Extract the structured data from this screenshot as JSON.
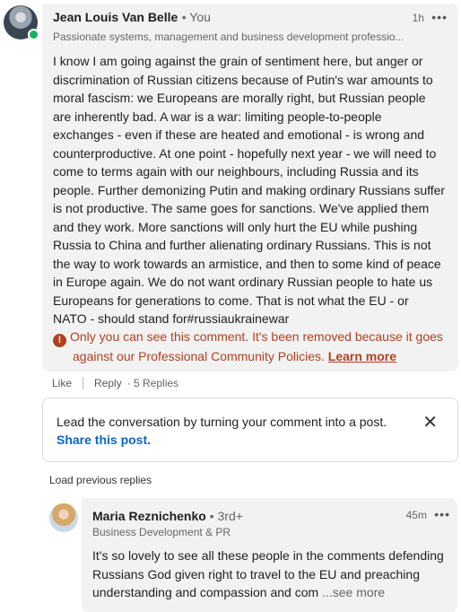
{
  "comment": {
    "author": "Jean Louis Van Belle",
    "author_suffix": "• You",
    "time": "1h",
    "menu_icon": "ellipsis-icon",
    "headline": "Passionate systems, management and business development professio...",
    "body": "I know I am going against the grain of sentiment here, but anger or discrimination of Russian citizens because of Putin's war amounts to moral fascism: we Europeans are morally right, but Russian people are inherently bad. A war is a war: limiting people-to-people exchanges - even if these are heated and emotional - is wrong and counterproductive. At one point - hopefully next year - we will need to come to terms again with our neighbours, including Russia and its people. Further demonizing Putin and making ordinary Russians suffer is not productive. The same goes for sanctions. We've applied them and they work. More sanctions will only hurt the EU while pushing Russia to China and further alienating ordinary Russians. This is not the way to work towards an armistice, and then to some kind of peace in Europe again. We do not want ordinary Russian people to hate us Europeans for generations to come. That is not what the EU - or NATO - should stand for#russiaukrainewar",
    "warning_icon": "warning-icon",
    "warning_line1": "Only you can see this comment. It's been removed because it goes",
    "warning_line2": "against our Professional Community Policies.",
    "learn_more": "Learn more",
    "online_color": "#19b05f",
    "warning_color": "#b24020"
  },
  "actions": {
    "like": "Like",
    "reply": "Reply",
    "replies_count": "· 5 Replies"
  },
  "share_prompt": {
    "text": "Lead the conversation by turning your comment into a post.",
    "link": "Share this post.",
    "close_icon": "close-icon",
    "link_color": "#0a66c2"
  },
  "load_previous": "Load previous replies",
  "reply": {
    "author": "Maria Reznichenko",
    "degree": "• 3rd+",
    "time": "45m",
    "headline": "Business Development & PR",
    "text": "It's so lovely to see all these people in the comments defending Russians God given right to travel to the EU and preaching understanding and compassion and com",
    "see_more": "...see more"
  }
}
